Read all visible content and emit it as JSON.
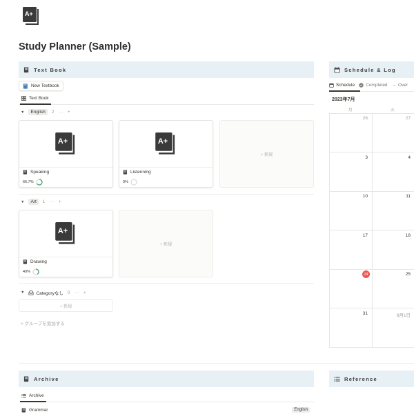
{
  "page": {
    "title": "Study Planner (Sample)",
    "icon": "a-plus-book-icon"
  },
  "textbook_section": {
    "header": "Text Book",
    "new_button": "New Textbook",
    "view_tab": "Text Book",
    "groups": [
      {
        "tag": "English",
        "count": "2",
        "more": "···",
        "add": "+",
        "cards": [
          {
            "name": "Speaking",
            "progress": "66.7%",
            "progress_value": 0.667
          },
          {
            "name": "Listenning",
            "progress": "0%",
            "progress_value": 0
          }
        ],
        "new_label": "+ 新規"
      },
      {
        "tag": "Art",
        "count": "1",
        "more": "···",
        "add": "+",
        "cards": [
          {
            "name": "Drawing",
            "progress": "40%",
            "progress_value": 0.4
          }
        ],
        "new_label": "+ 新規"
      },
      {
        "label": "Categoryなし",
        "count": "0",
        "more": "···",
        "add": "+",
        "new_label": "+ 新規"
      }
    ],
    "add_group": "+ グループを追加する"
  },
  "schedule_section": {
    "header": "Schedule & Log",
    "tabs": [
      "Schedule",
      "Completed",
      "Over"
    ],
    "month": "2023年7月",
    "weekdays": [
      "月",
      "火"
    ],
    "weeks": [
      [
        "26",
        "27"
      ],
      [
        "3",
        "4"
      ],
      [
        "10",
        "11"
      ],
      [
        "17",
        "18"
      ],
      [
        "24",
        "25"
      ],
      [
        "31",
        "8月1日"
      ]
    ],
    "today": "24"
  },
  "archive_section": {
    "header": "Archive",
    "view_tab": "Archive",
    "rows": [
      {
        "name": "Grammar",
        "tag": "English"
      }
    ]
  },
  "reference_section": {
    "header": "Reference"
  },
  "colors": {
    "section_header_bg": "#e6f0f5",
    "today_marker": "#eb5757",
    "progress_ring": "#3d9b6b",
    "text": "#37352f"
  }
}
